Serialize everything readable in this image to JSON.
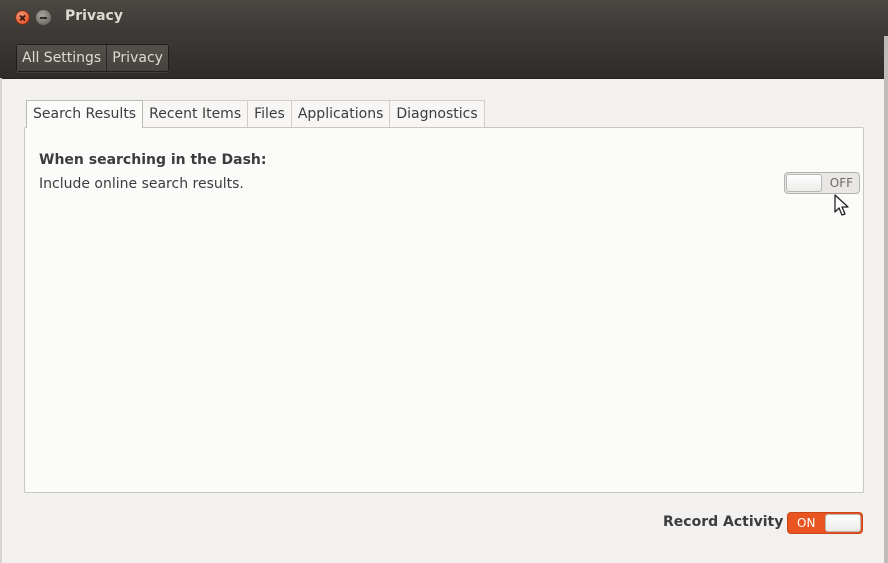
{
  "window": {
    "title": "Privacy"
  },
  "breadcrumb": {
    "items": [
      "All Settings",
      "Privacy"
    ]
  },
  "tabs": [
    "Search Results",
    "Recent Items",
    "Files",
    "Applications",
    "Diagnostics"
  ],
  "active_tab": "Search Results",
  "search_results": {
    "heading": "When searching in the Dash:",
    "description": "Include online search results.",
    "toggle_state": "OFF"
  },
  "record_activity": {
    "label": "Record Activity",
    "toggle_state": "ON"
  },
  "colors": {
    "accent": "#e95420",
    "titlebar": "#3b3935"
  },
  "icons": [
    "close-icon",
    "minimize-icon",
    "mouse-cursor-icon"
  ]
}
